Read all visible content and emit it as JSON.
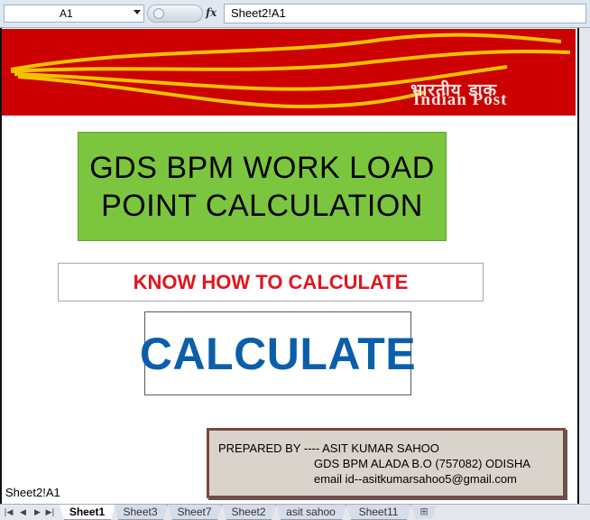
{
  "formula_bar": {
    "name_box": "A1",
    "formula": "Sheet2!A1"
  },
  "banner": {
    "hindi_text": "भारतीय डाक",
    "english_text": "Indian Post",
    "colors": {
      "background": "#cc0000",
      "stripes": "#f2c200"
    }
  },
  "main": {
    "title_lines": [
      "GDS BPM WORK LOAD",
      "POINT CALCULATION"
    ],
    "know_how_label": "KNOW HOW TO CALCULATE",
    "calculate_label": "CALCULATE",
    "colors": {
      "title_bg": "#7cc63f",
      "know_how_text": "#e0161f",
      "calculate_text": "#0b5faa"
    }
  },
  "credits": {
    "line1": "PREPARED BY ---- ASIT KUMAR SAHOO",
    "line2": "GDS BPM ALADA B.O  (757082) ODISHA",
    "line3": "email id--asitkumarsahoo5@gmail.com"
  },
  "cell_reference": "Sheet2!A1",
  "tabs": {
    "items": [
      {
        "label": "Sheet1",
        "active": true
      },
      {
        "label": "Sheet3",
        "active": false
      },
      {
        "label": "Sheet7",
        "active": false
      },
      {
        "label": "Sheet2",
        "active": false
      },
      {
        "label": "asit sahoo",
        "active": false
      },
      {
        "label": "Sheet11",
        "active": false
      }
    ],
    "nav_icons": [
      "first-sheet-icon",
      "prev-sheet-icon",
      "next-sheet-icon",
      "last-sheet-icon"
    ]
  }
}
